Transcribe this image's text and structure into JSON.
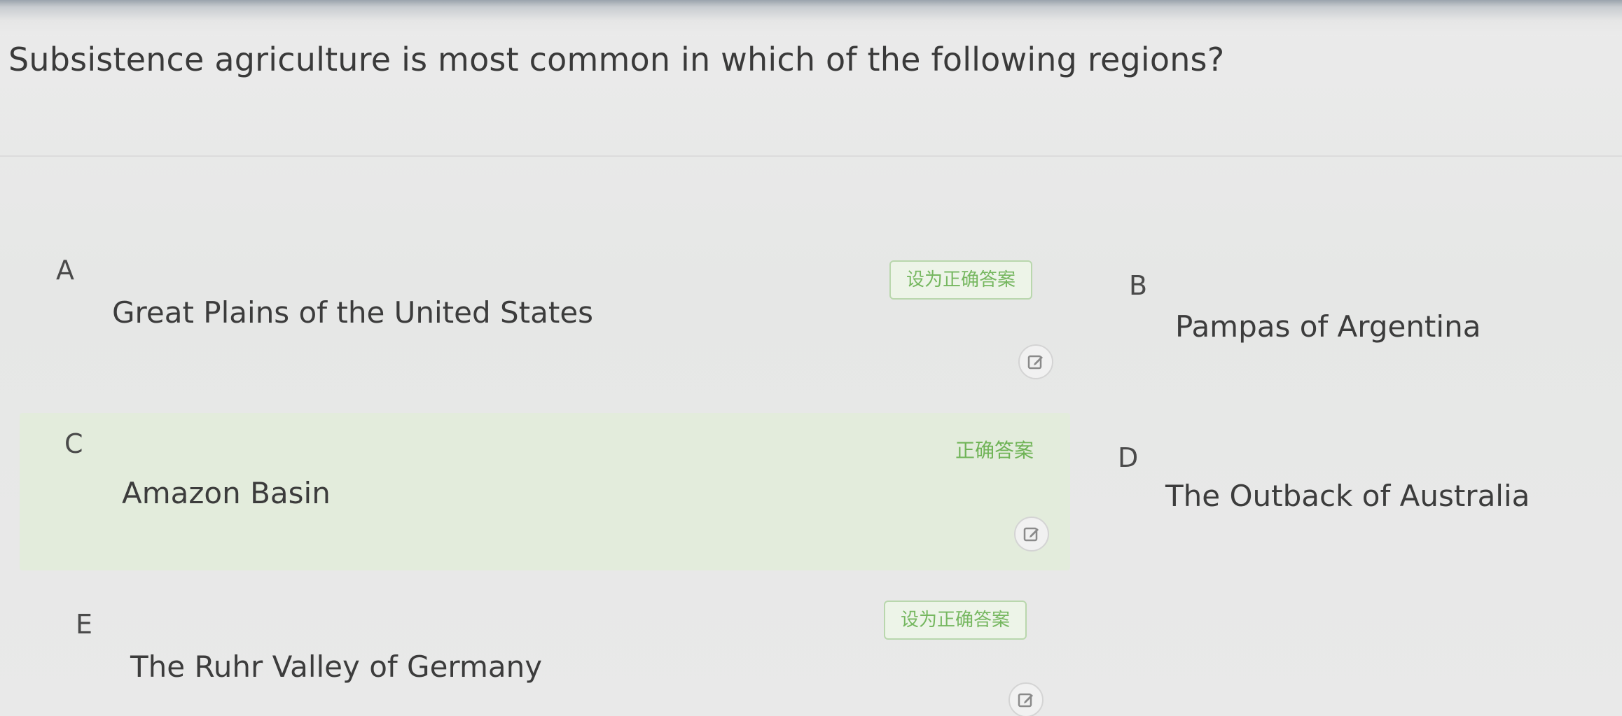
{
  "question": {
    "text": "Subsistence agriculture is most common in which of the following regions?"
  },
  "options": [
    {
      "letter": "A",
      "text": "Great Plains of the United States",
      "action_label": "设为正确答案",
      "is_correct": false
    },
    {
      "letter": "B",
      "text": "Pampas of Argentina",
      "is_correct": false
    },
    {
      "letter": "C",
      "text": "Amazon Basin",
      "action_label": "正确答案",
      "is_correct": true
    },
    {
      "letter": "D",
      "text": "The Outback of Australia",
      "is_correct": false
    },
    {
      "letter": "E",
      "text": "The Ruhr Valley of Germany",
      "action_label": "设为正确答案",
      "is_correct": false
    }
  ],
  "icons": {
    "edit": "edit-icon"
  },
  "colors": {
    "correct_background": "#e3ecdc",
    "accent_green": "#76b760",
    "text": "#3c3c3c"
  }
}
